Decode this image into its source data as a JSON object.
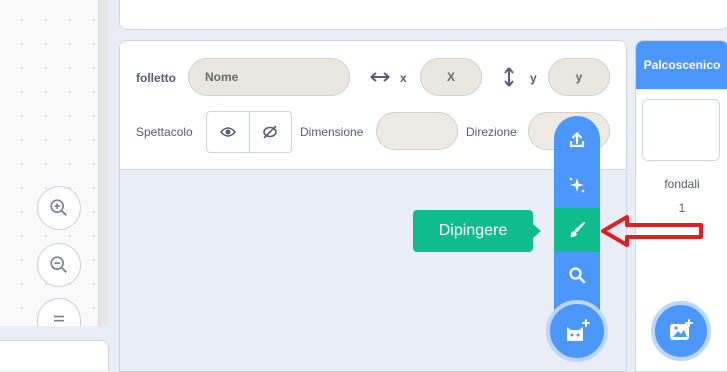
{
  "sprite_info": {
    "sprite_label": "folletto",
    "name_placeholder": "Nome",
    "x_label": "x",
    "x_value": "X",
    "y_label": "y",
    "y_value": "y",
    "show_label": "Spettacolo",
    "size_label": "Dimensione",
    "direction_label": "Direzione"
  },
  "stage": {
    "header": "Palcoscenico",
    "backdrops_label": "fondali",
    "backdrops_count": "1"
  },
  "tooltip": {
    "text": "Dipingere"
  },
  "colors": {
    "scratch_blue": "#4c97ff",
    "paint_green": "#0fbd8c",
    "annotation_red": "#e02020"
  },
  "icons": {
    "zoom_in": "zoom-in-icon",
    "zoom_out": "zoom-out-icon",
    "zoom_reset": "zoom-reset-icon",
    "upload": "upload-icon",
    "surprise": "surprise-sparkle-icon",
    "paint": "paintbrush-icon",
    "search": "search-icon",
    "sprite": "cat-sprite-icon",
    "backdrop": "image-add-icon"
  }
}
